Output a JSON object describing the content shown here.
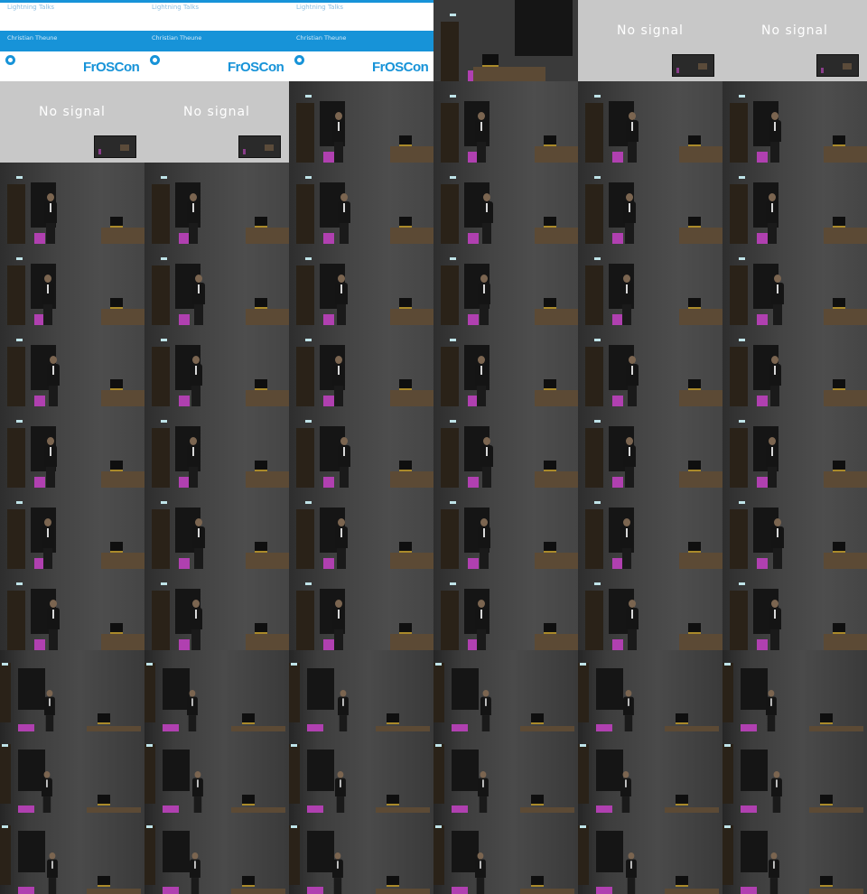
{
  "title_slide": {
    "talk_label": "Lightning Talks",
    "speaker": "Christian Theune",
    "logo_text": "FrOSCon",
    "fine_print": "",
    "tagline": ""
  },
  "no_signal": {
    "message": "No signal"
  },
  "frames": [
    {
      "kind": "slide"
    },
    {
      "kind": "slide"
    },
    {
      "kind": "slide"
    },
    {
      "kind": "stage-dark"
    },
    {
      "kind": "nosignal"
    },
    {
      "kind": "nosignal"
    },
    {
      "kind": "nosignal"
    },
    {
      "kind": "nosignal"
    },
    {
      "kind": "stage"
    },
    {
      "kind": "stage"
    },
    {
      "kind": "stage"
    },
    {
      "kind": "stage"
    },
    {
      "kind": "stage"
    },
    {
      "kind": "stage"
    },
    {
      "kind": "stage"
    },
    {
      "kind": "stage"
    },
    {
      "kind": "stage"
    },
    {
      "kind": "stage"
    },
    {
      "kind": "stage"
    },
    {
      "kind": "stage"
    },
    {
      "kind": "stage"
    },
    {
      "kind": "stage"
    },
    {
      "kind": "stage"
    },
    {
      "kind": "stage"
    },
    {
      "kind": "stage"
    },
    {
      "kind": "stage"
    },
    {
      "kind": "stage"
    },
    {
      "kind": "stage"
    },
    {
      "kind": "stage"
    },
    {
      "kind": "stage"
    },
    {
      "kind": "stage"
    },
    {
      "kind": "stage"
    },
    {
      "kind": "stage"
    },
    {
      "kind": "stage"
    },
    {
      "kind": "stage"
    },
    {
      "kind": "stage"
    },
    {
      "kind": "stage"
    },
    {
      "kind": "stage"
    },
    {
      "kind": "stage"
    },
    {
      "kind": "stage"
    },
    {
      "kind": "stage"
    },
    {
      "kind": "stage"
    },
    {
      "kind": "stage"
    },
    {
      "kind": "stage"
    },
    {
      "kind": "stage"
    },
    {
      "kind": "stage"
    },
    {
      "kind": "stage"
    },
    {
      "kind": "stage"
    },
    {
      "kind": "wide"
    },
    {
      "kind": "wide"
    },
    {
      "kind": "wide"
    },
    {
      "kind": "wide"
    },
    {
      "kind": "wide"
    },
    {
      "kind": "wide"
    },
    {
      "kind": "wide"
    },
    {
      "kind": "wide"
    },
    {
      "kind": "wide"
    },
    {
      "kind": "wide"
    },
    {
      "kind": "wide"
    },
    {
      "kind": "wide"
    },
    {
      "kind": "wide"
    },
    {
      "kind": "wide"
    },
    {
      "kind": "wide"
    },
    {
      "kind": "wide"
    },
    {
      "kind": "wide"
    },
    {
      "kind": "wide"
    }
  ],
  "colors": {
    "brand_blue": "#1793d8",
    "no_signal_bg": "#c8c8c8",
    "stage_light": "#b040b0"
  }
}
